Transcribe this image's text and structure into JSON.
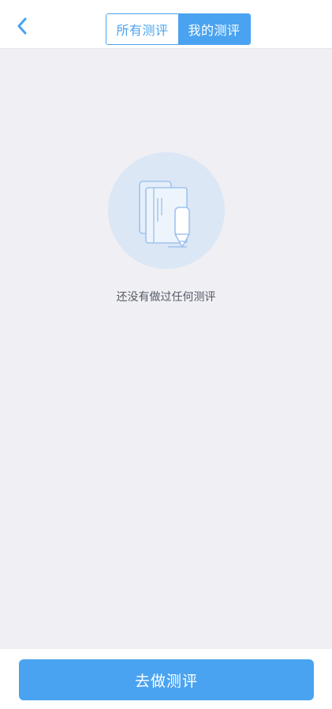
{
  "header": {
    "back_icon": "chevron-left-icon",
    "tabs": [
      {
        "label": "所有测评",
        "active": false
      },
      {
        "label": "我的测评",
        "active": true
      }
    ]
  },
  "empty_state": {
    "icon": "book-pencil-icon",
    "message": "还没有做过任何测评"
  },
  "footer": {
    "cta_label": "去做测评"
  },
  "colors": {
    "accent": "#4aa3f0",
    "background": "#efeff4",
    "illustration_circle": "#dce7f5"
  }
}
